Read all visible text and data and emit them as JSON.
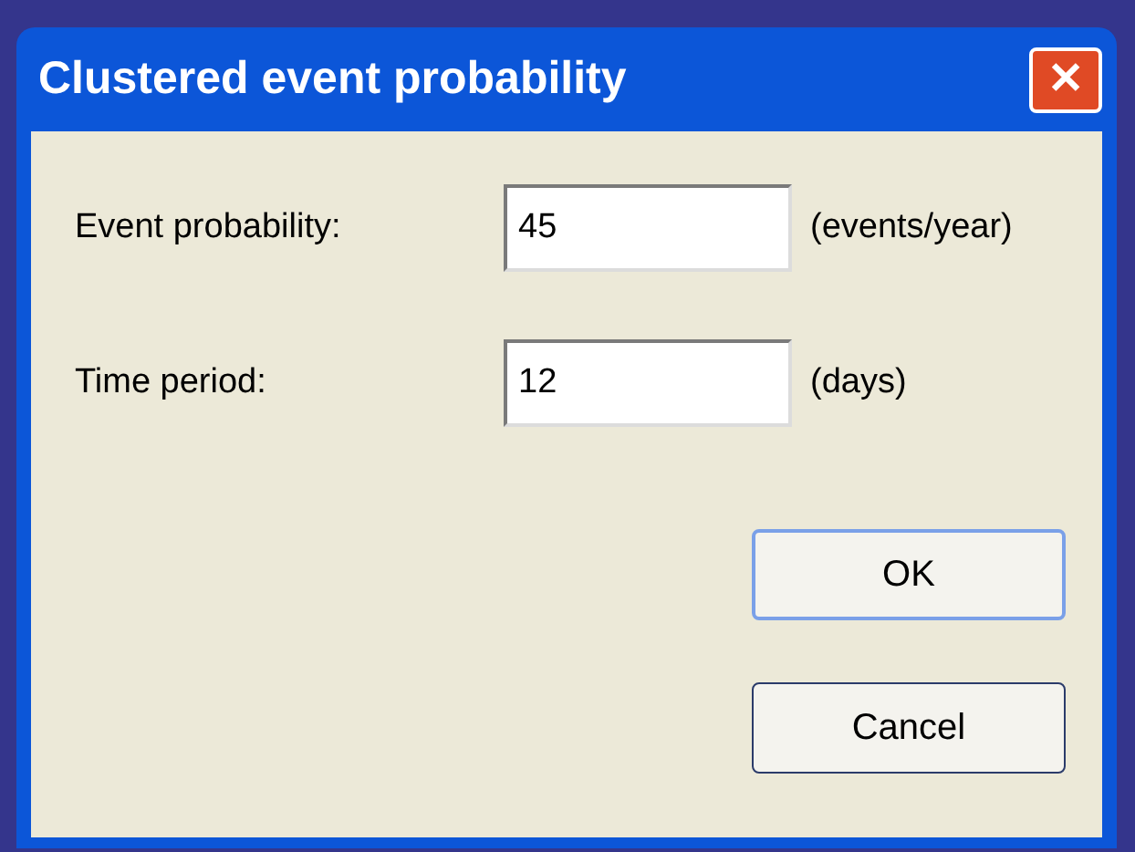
{
  "window": {
    "title": "Clustered event probability",
    "close": "✕"
  },
  "fields": [
    {
      "label": "Event probability:",
      "value": "45",
      "unit": "(events/year)"
    },
    {
      "label": "Time period:",
      "value": "12",
      "unit": "(days)"
    }
  ],
  "buttons": [
    "OK",
    "Cancel"
  ]
}
